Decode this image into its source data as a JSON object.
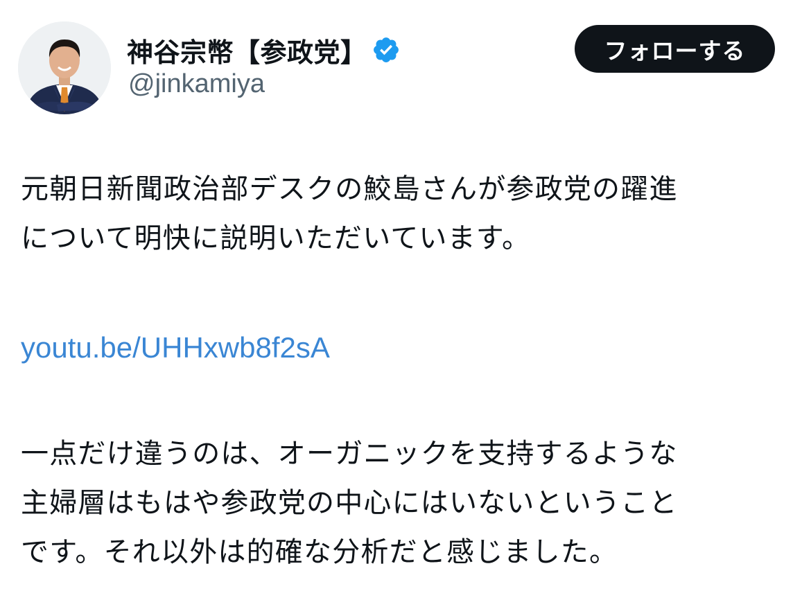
{
  "author": {
    "display_name": "神谷宗幣【参政党】",
    "handle": "@jinkamiya",
    "verified": true,
    "verified_color": "#1d9bf0",
    "avatar_icon": "profile-photo"
  },
  "follow_button": {
    "label": "フォローする",
    "background": "#0f1419",
    "text_color": "#ffffff"
  },
  "tweet": {
    "paragraph1": [
      "元朝日新聞政治部デスクの鮫島さんが参政党の躍進",
      "について明快に説明いただいています。"
    ],
    "link": {
      "text": "youtu.be/UHHxwb8f2sA",
      "color": "#3a86d4"
    },
    "paragraph2": [
      "一点だけ違うのは、オーガニックを支持するような",
      "主婦層はもはや参政党の中心にはいないということ",
      "です。それ以外は的確な分析だと感じました。"
    ]
  }
}
